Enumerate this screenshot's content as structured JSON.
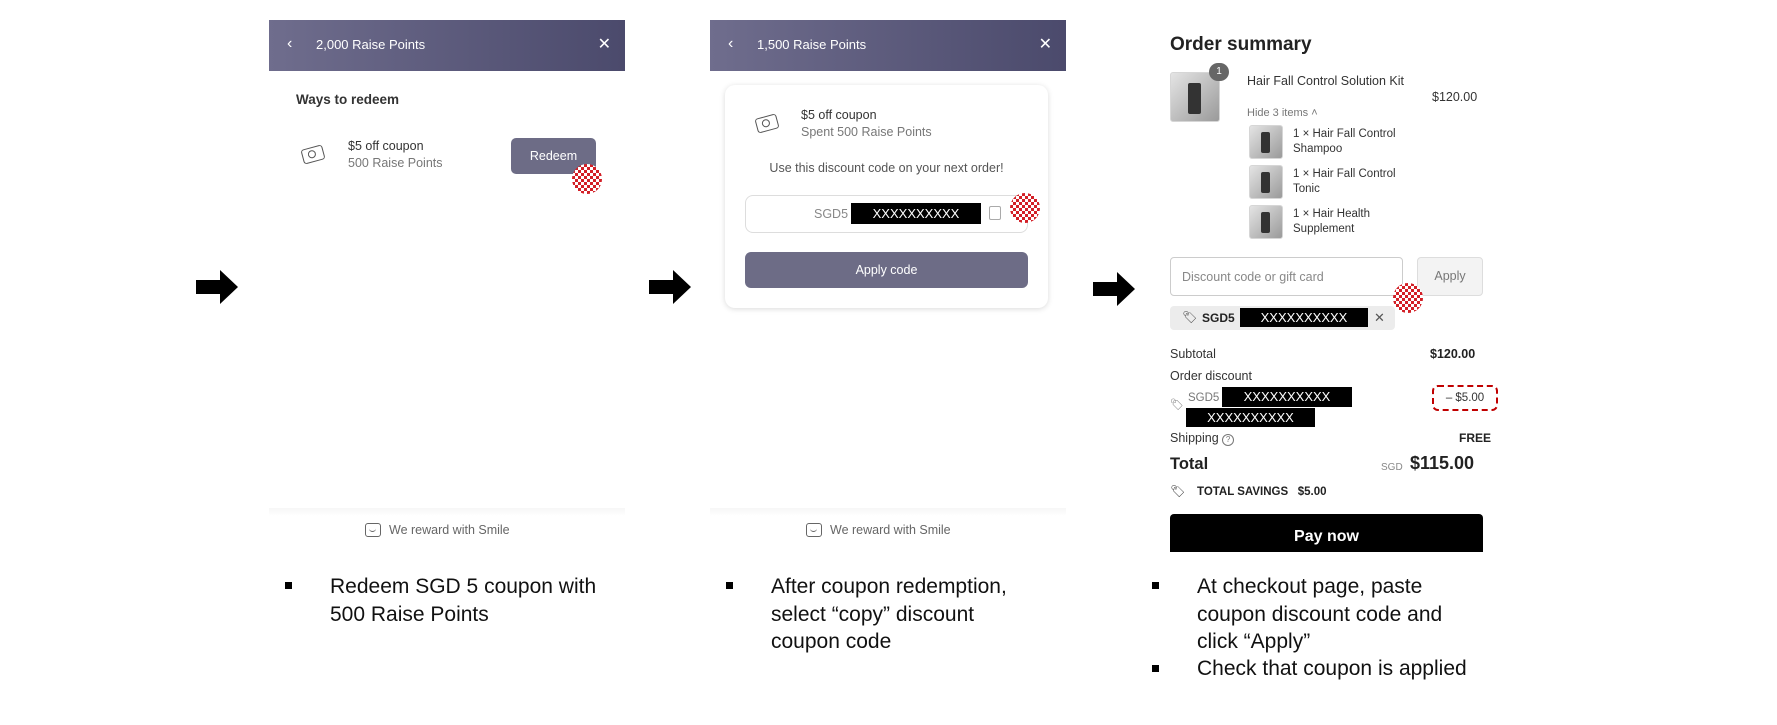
{
  "panel1": {
    "header_title": "2,000 Raise Points",
    "section_title": "Ways to redeem",
    "coupon_title": "$5 off coupon",
    "coupon_points": "500 Raise Points",
    "redeem_label": "Redeem",
    "footer": "We reward with Smile"
  },
  "panel2": {
    "header_title": "1,500 Raise Points",
    "coupon_title": "$5 off coupon",
    "coupon_spent": "Spent 500 Raise Points",
    "instruction": "Use this discount code on your next order!",
    "code_prefix": "SGD5",
    "code_redacted": "XXXXXXXXXX",
    "apply_label": "Apply code",
    "footer": "We reward with Smile"
  },
  "panel3": {
    "title": "Order summary",
    "product_name": "Hair Fall Control Solution Kit",
    "product_qty_badge": "1",
    "product_price": "$120.00",
    "hide_items": "Hide 3 items",
    "sub_items": [
      "1 × Hair Fall Control Shampoo",
      "1 × Hair Fall Control Tonic",
      "1 × Hair Health Supplement"
    ],
    "discount_placeholder": "Discount code or gift card",
    "apply_label": "Apply",
    "applied_code_prefix": "SGD5",
    "code_redacted": "XXXXXXXXXX",
    "subtotal_label": "Subtotal",
    "subtotal_value": "$120.00",
    "order_discount_label": "Order discount",
    "discount_code_prefix": "SGD5",
    "discount_value": "– $5.00",
    "shipping_label": "Shipping",
    "shipping_value": "FREE",
    "total_label": "Total",
    "total_currency": "SGD",
    "total_value": "$115.00",
    "savings_label": "TOTAL SAVINGS",
    "savings_value": "$5.00",
    "pay_label": "Pay now"
  },
  "captions": {
    "step1": [
      "Redeem SGD 5 coupon with",
      "500 Raise Points"
    ],
    "step2": [
      "After coupon redemption,",
      "select “copy” discount",
      "coupon code"
    ],
    "step3": [
      "At checkout page, paste",
      "coupon discount code and",
      "click “Apply”"
    ],
    "step3b": "Check that coupon is applied"
  }
}
